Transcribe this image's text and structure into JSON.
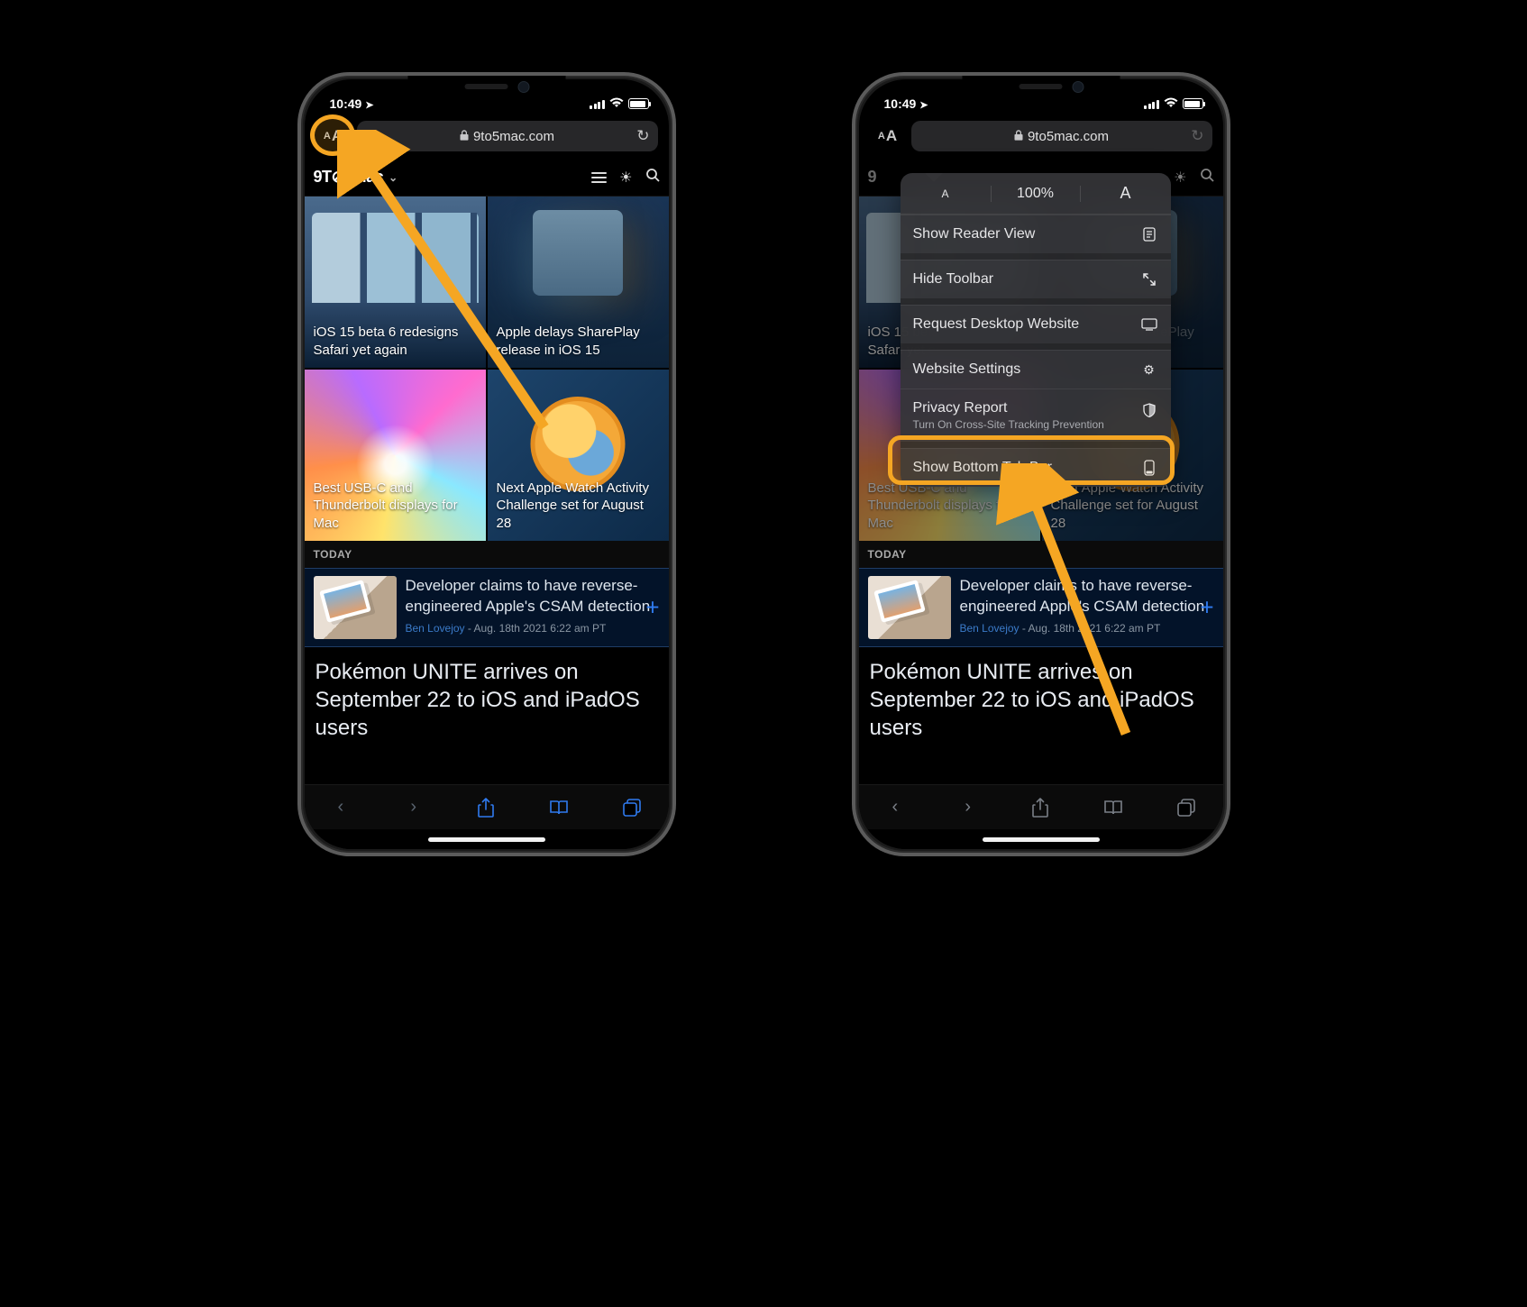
{
  "status": {
    "time": "10:49",
    "loc_icon": "➤"
  },
  "address": {
    "aA_small": "A",
    "aA_large": "A",
    "url": "9to5mac.com"
  },
  "site": {
    "logo": "9T⊘5Mac"
  },
  "tiles": [
    "iOS 15 beta 6 redesigns Safari yet again",
    "Apple delays SharePlay release in iOS 15",
    "Best USB-C and Thunderbolt displays for Mac",
    "Next Apple Watch Activity Challenge set for August 28"
  ],
  "today_label": "TODAY",
  "story": {
    "headline": "Developer claims to have reverse-engineered Apple's CSAM detection",
    "author": "Ben Lovejoy",
    "meta_rest": " - Aug. 18th 2021 6:22 am PT"
  },
  "story2": "Pokémon UNITE arrives on September 22 to iOS and iPadOS users",
  "popover": {
    "zoom": "100%",
    "reader": "Show Reader View",
    "hide_toolbar": "Hide Toolbar",
    "desktop": "Request Desktop Website",
    "settings": "Website Settings",
    "privacy_title": "Privacy Report",
    "privacy_sub": "Turn On Cross-Site Tracking Prevention",
    "bottom_tab": "Show Bottom Tab Bar"
  }
}
